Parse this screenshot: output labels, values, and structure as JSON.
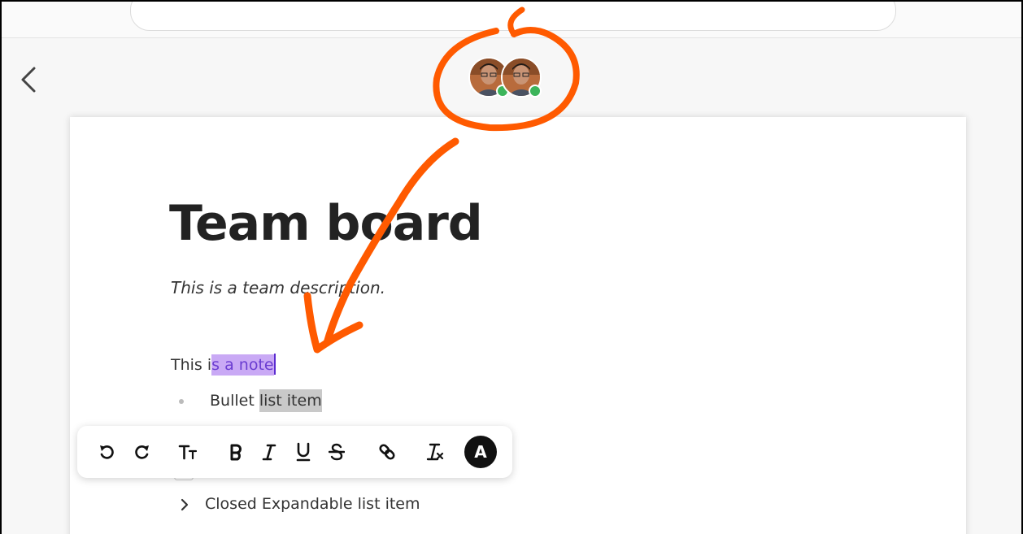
{
  "header": {
    "back_icon": "chevron-left-icon"
  },
  "collaborators": [
    {
      "name": "avatar",
      "status": "online"
    },
    {
      "name": "avatar",
      "status": "online"
    }
  ],
  "document": {
    "title": "Team board",
    "description": "This is a team description.",
    "note_prefix": "This i",
    "note_selected": "s a note",
    "bullet_prefix": "Bullet ",
    "bullet_highlight": "list item",
    "expandable_label": "Closed Expandable list item"
  },
  "toolbar": {
    "items": [
      "undo-icon",
      "redo-icon",
      "text-size-icon",
      "bold-icon",
      "italic-icon",
      "underline-icon",
      "strikethrough-icon",
      "link-icon",
      "clear-format-icon"
    ],
    "color_button_label": "A"
  },
  "colors": {
    "annotation": "#ff5a00",
    "selection": "#c9a9f5",
    "online": "#3cb45a"
  }
}
